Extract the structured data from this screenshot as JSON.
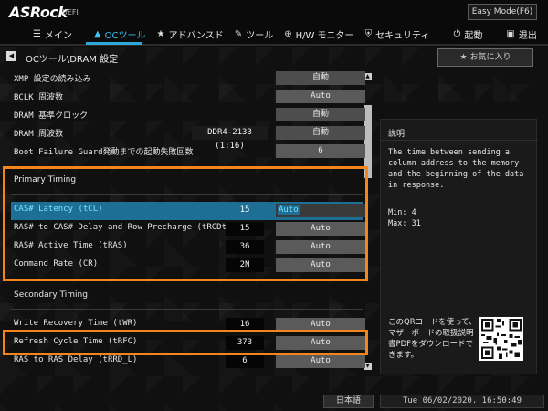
{
  "header": {
    "brand": "ASRock",
    "brand_sub": "UEFI",
    "easy_mode_label": "Easy Mode(F6)"
  },
  "nav": {
    "items": [
      {
        "label": "メイン",
        "icon": "list-icon",
        "glyph": "☰"
      },
      {
        "label": "OCツール",
        "icon": "rocket-icon",
        "glyph": "▲"
      },
      {
        "label": "アドバンスド",
        "icon": "star-icon",
        "glyph": "★"
      },
      {
        "label": "ツール",
        "icon": "wrench-icon",
        "glyph": "✎"
      },
      {
        "label": "H/W モニター",
        "icon": "monitor-icon",
        "glyph": "⊕"
      },
      {
        "label": "セキュリティ",
        "icon": "shield-icon",
        "glyph": "⛨"
      },
      {
        "label": "起動",
        "icon": "power-icon",
        "glyph": "⏻"
      },
      {
        "label": "退出",
        "icon": "exit-icon",
        "glyph": "▣"
      }
    ]
  },
  "breadcrumb": "OCツール\\DRAM 設定",
  "favorite_label": "お気に入り",
  "settings": [
    {
      "label": "XMP 設定の読み込み",
      "current": "",
      "value": "自動"
    },
    {
      "label": "BCLK 周波数",
      "current": "",
      "value": "Auto"
    },
    {
      "label": "DRAM 基準クロック",
      "current": "",
      "value": "自動"
    },
    {
      "label": "DRAM 周波数",
      "current": "DDR4-2133 (1:16)",
      "value": "自動"
    },
    {
      "label": "Boot Failure Guard発動までの起動失敗回数",
      "current": "",
      "value": "6"
    }
  ],
  "primary": {
    "title": "Primary Timing",
    "rows": [
      {
        "label": "CAS# Latency (tCL)",
        "current": "15",
        "value": "Auto"
      },
      {
        "label": "RAS# to CAS# Delay and Row Precharge (tRCDtRP)",
        "current": "15",
        "value": "Auto"
      },
      {
        "label": "RAS# Active Time (tRAS)",
        "current": "36",
        "value": "Auto"
      },
      {
        "label": "Command Rate (CR)",
        "current": "2N",
        "value": "Auto"
      }
    ]
  },
  "secondary": {
    "title": "Secondary Timing",
    "rows": [
      {
        "label": "Write Recovery Time (tWR)",
        "current": "16",
        "value": "Auto"
      },
      {
        "label": "Refresh Cycle Time (tRFC)",
        "current": "373",
        "value": "Auto"
      },
      {
        "label": "RAS to RAS Delay (tRRD_L)",
        "current": "6",
        "value": "Auto"
      }
    ]
  },
  "description": {
    "title": "説明",
    "text": "The time between sending a column address to the memory and the beginning of the data in response.",
    "min": "Min: 4",
    "max": "Max: 31",
    "qr_text": "このQRコードを使って、マザーボードの取扱説明書PDFをダウンロードできます。"
  },
  "footer": {
    "language": "日本語",
    "datetime": "Tue 06/02/2020. 16:50:49"
  },
  "colors": {
    "accent": "#2ea8d8",
    "highlight_row": "#1d6f95",
    "callout": "#f3861b"
  }
}
